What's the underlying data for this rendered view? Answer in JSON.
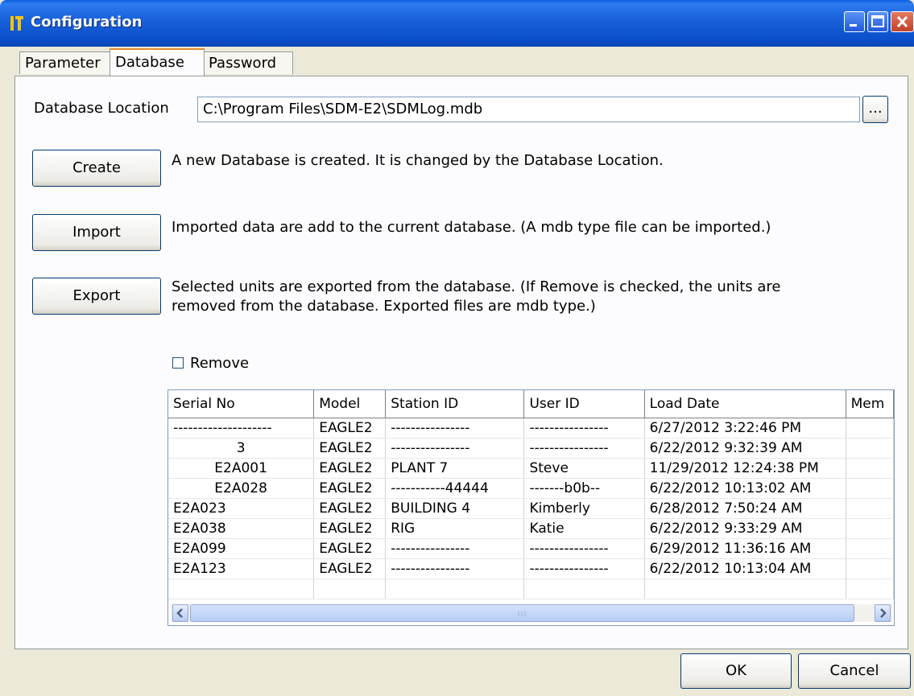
{
  "window": {
    "title": "Configuration",
    "icon": "app-icon"
  },
  "tabs": [
    {
      "label": "Parameter",
      "active": false
    },
    {
      "label": "Database",
      "active": true
    },
    {
      "label": "Password",
      "active": false
    }
  ],
  "database": {
    "location_label": "Database Location",
    "location_value": "C:\\Program Files\\SDM-E2\\SDMLog.mdb",
    "browse_label": "...",
    "create_label": "Create",
    "create_desc": "A new Database is created. It is changed by the Database Location.",
    "import_label": "Import",
    "import_desc": "Imported data are add to the current database. (A mdb type file can be imported.)",
    "export_label": "Export",
    "export_desc_line1": "Selected units are exported from the database. (If Remove is checked, the units are",
    "export_desc_line2": "removed from the database. Exported files are mdb type.)",
    "remove_label": "Remove",
    "remove_checked": false
  },
  "grid": {
    "columns": [
      "Serial No",
      "Model",
      "Station ID",
      "User ID",
      "Load Date",
      "Mem"
    ],
    "rows": [
      [
        "--------------------",
        "EAGLE2",
        "----------------",
        "----------------",
        "6/27/2012 3:22:46 PM",
        ""
      ],
      [
        "3",
        "EAGLE2",
        "----------------",
        "----------------",
        "6/22/2012 9:32:39 AM",
        ""
      ],
      [
        "E2A001",
        "EAGLE2",
        "PLANT 7",
        "Steve",
        "11/29/2012 12:24:38 PM",
        ""
      ],
      [
        "E2A028",
        "EAGLE2",
        "-----------44444",
        "-------b0b--",
        "6/22/2012 10:13:02 AM",
        ""
      ],
      [
        "E2A023",
        "EAGLE2",
        "BUILDING 4",
        "Kimberly",
        "6/28/2012 7:50:24 AM",
        ""
      ],
      [
        "E2A038",
        "EAGLE2",
        "RIG",
        "Katie",
        "6/22/2012 9:33:29 AM",
        ""
      ],
      [
        "E2A099",
        "EAGLE2",
        "----------------",
        "----------------",
        "6/29/2012 11:36:16 AM",
        ""
      ],
      [
        "E2A123",
        "EAGLE2",
        "----------------",
        "----------------",
        "6/22/2012 10:13:04 AM",
        ""
      ],
      [
        "",
        "",
        "",
        "",
        "",
        ""
      ]
    ],
    "centered_serial_rows": [
      1,
      2,
      3
    ]
  },
  "footer": {
    "ok_label": "OK",
    "cancel_label": "Cancel"
  },
  "colors": {
    "titlebar": "#0A5FE0",
    "window_bg": "#ECE9D8",
    "panel_bg": "#FCFCFE",
    "active_tab_accent": "#E68B2C"
  }
}
